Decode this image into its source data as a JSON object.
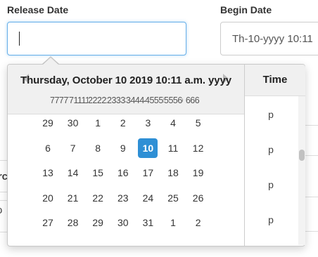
{
  "form": {
    "release_date": {
      "label": "Release Date",
      "value": ""
    },
    "begin_date": {
      "label": "Begin Date",
      "value": "Th-10-yyyy 10:11"
    }
  },
  "background": {
    "left_fragment_a": "rc",
    "left_fragment_b": "o |"
  },
  "datepicker": {
    "title": "Thursday, October 10 2019 10:11 a.m. yyyy",
    "weekday_headers": [
      "77777",
      "71111",
      "22222",
      "23333",
      "34444",
      "45555",
      "55566",
      "666"
    ],
    "weeks": [
      [
        "29",
        "30",
        "1",
        "2",
        "3",
        "4",
        "5"
      ],
      [
        "6",
        "7",
        "8",
        "9",
        "10",
        "11",
        "12"
      ],
      [
        "13",
        "14",
        "15",
        "16",
        "17",
        "18",
        "19"
      ],
      [
        "20",
        "21",
        "22",
        "23",
        "24",
        "25",
        "26"
      ],
      [
        "27",
        "28",
        "29",
        "30",
        "31",
        "1",
        "2"
      ]
    ],
    "selected_day": "10",
    "accent_color": "#2e8fd5",
    "time": {
      "header": "Time",
      "items": [
        "p",
        "p",
        "p",
        "p"
      ]
    }
  }
}
